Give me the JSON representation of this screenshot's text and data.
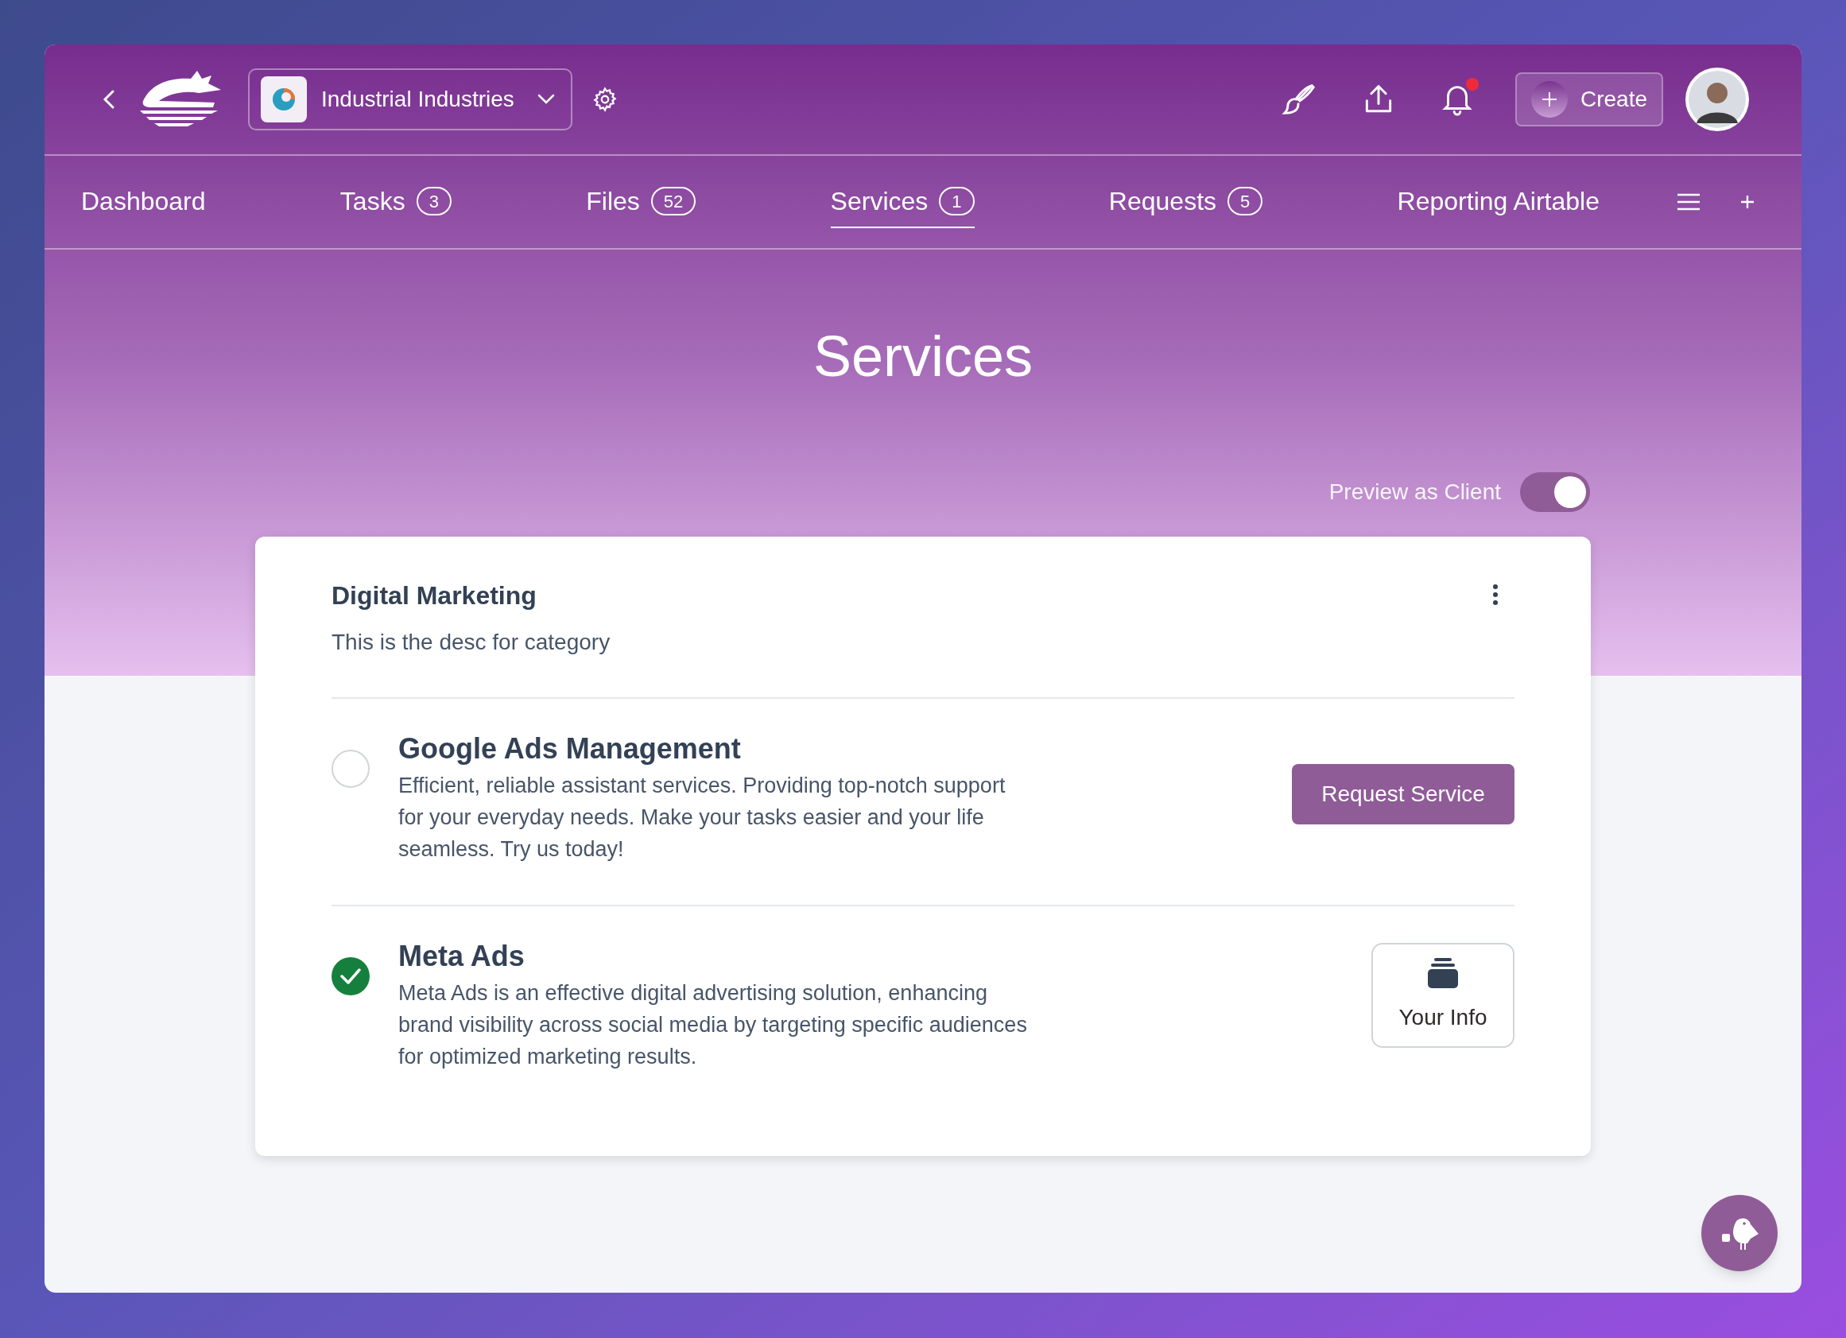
{
  "header": {
    "workspace": {
      "name": "Industrial Industries"
    },
    "notifications": {
      "unread": true
    },
    "create_button": {
      "label": "Create"
    }
  },
  "nav": {
    "tabs": [
      {
        "label": "Dashboard",
        "selected": false
      },
      {
        "label": "Tasks",
        "count": "3",
        "selected": false
      },
      {
        "label": "Files",
        "count": "52",
        "selected": false
      },
      {
        "label": "Services",
        "count": "1",
        "selected": true
      },
      {
        "label": "Requests",
        "count": "5",
        "selected": false
      },
      {
        "label": "Reporting Airtable",
        "selected": false
      }
    ]
  },
  "page_title": "Services",
  "preview_toggle": {
    "label": "Preview as Client",
    "on": true
  },
  "category": {
    "title": "Digital Marketing",
    "description": "This is the desc for category",
    "services": [
      {
        "name": "Google Ads Management",
        "description": "Efficient, reliable assistant services. Providing top-notch support for your everyday needs. Make your tasks easier and your life seamless. Try us today!",
        "checked": false,
        "action": {
          "kind": "request",
          "label": "Request Service"
        }
      },
      {
        "name": "Meta Ads",
        "description": "Meta Ads is an effective digital advertising solution, enhancing brand visibility across social media by targeting specific audiences for optimized marketing results.",
        "checked": true,
        "action": {
          "kind": "info",
          "label": "Your Info"
        }
      }
    ]
  }
}
